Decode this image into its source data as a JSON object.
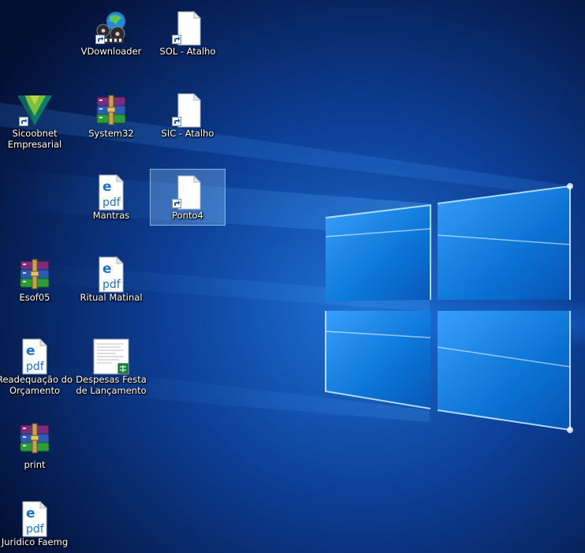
{
  "desktop": {
    "icons": [
      {
        "label": "VDownloader",
        "icon": "vdownloader-film-globe-icon",
        "shortcut": true
      },
      {
        "label": "SOL - Atalho",
        "icon": "blank-file-icon",
        "shortcut": true
      },
      {
        "label": "Sicoobnet\nEmpresarial",
        "icon": "sicoobnet-logo-icon",
        "shortcut": true
      },
      {
        "label": "System32",
        "icon": "winrar-archive-icon",
        "shortcut": false
      },
      {
        "label": "SIC - Atalho",
        "icon": "blank-file-icon",
        "shortcut": true
      },
      {
        "label": "Mantras",
        "icon": "edge-pdf-icon",
        "shortcut": false
      },
      {
        "label": "Ponto4",
        "icon": "blank-file-icon",
        "shortcut": true,
        "selected": true
      },
      {
        "label": "Esof05",
        "icon": "winrar-archive-icon",
        "shortcut": false
      },
      {
        "label": "Ritual Matinal",
        "icon": "edge-pdf-icon",
        "shortcut": false
      },
      {
        "label": "Readequação do\nOrçamento",
        "icon": "edge-pdf-icon",
        "shortcut": false
      },
      {
        "label": "Despesas Festa\nde Lançamento",
        "icon": "spreadsheet-document-icon",
        "shortcut": false
      },
      {
        "label": "print",
        "icon": "winrar-archive-icon",
        "shortcut": false
      },
      {
        "label": "Juridico Faemg",
        "icon": "edge-pdf-icon",
        "shortcut": false
      }
    ],
    "pdf_glyph_text": "pdf",
    "edge_glyph_text": "e"
  }
}
